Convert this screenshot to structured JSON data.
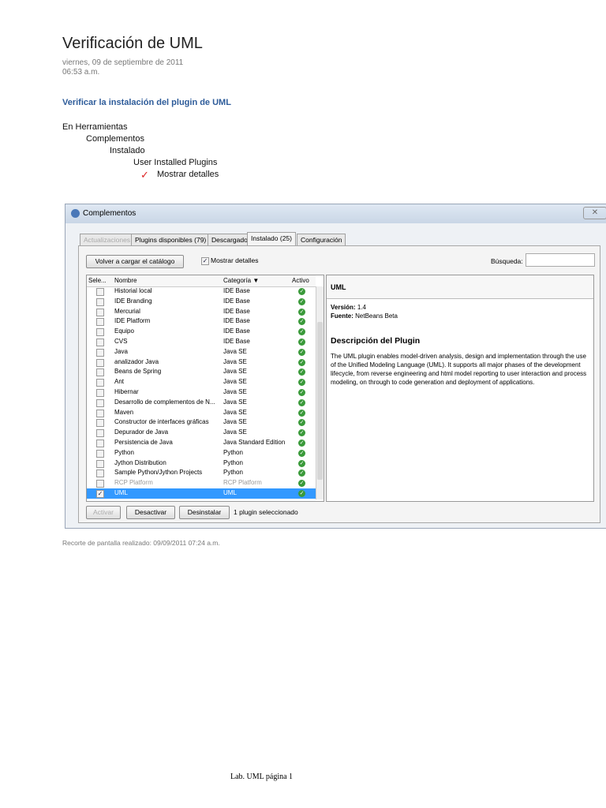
{
  "doc": {
    "title": "Verificación de UML",
    "date": "viernes, 09 de septiembre de 2011",
    "time": "06:53 a.m.",
    "subtitle": "Verificar la instalación del plugin de UML",
    "steps": [
      "En Herramientas",
      "Complementos",
      "Instalado",
      "User Installed Plugins",
      "Mostrar detalles"
    ],
    "caption": "Recorte de pantalla realizado: 09/09/2011 07:24 a.m.",
    "footer": "Lab. UML página 1"
  },
  "dialog": {
    "title": "Complementos",
    "close": "✕",
    "tabs": [
      "Actualizaciones",
      "Plugins disponibles (79)",
      "Descargado",
      "Instalado (25)",
      "Configuración"
    ],
    "reload": "Volver a cargar el catálogo",
    "show_details": "Mostrar detalles",
    "search_label": "Búsqueda:",
    "search_value": "",
    "columns": [
      "Sele...",
      "Nombre",
      "Categoría ▼",
      "Activo"
    ],
    "rows": [
      {
        "name": "Historial local",
        "cat": "IDE Base"
      },
      {
        "name": "IDE Branding",
        "cat": "IDE Base"
      },
      {
        "name": "Mercurial",
        "cat": "IDE Base"
      },
      {
        "name": "IDE Platform",
        "cat": "IDE Base"
      },
      {
        "name": "Equipo",
        "cat": "IDE Base"
      },
      {
        "name": "CVS",
        "cat": "IDE Base"
      },
      {
        "name": "Java",
        "cat": "Java SE"
      },
      {
        "name": "analizador Java",
        "cat": "Java SE"
      },
      {
        "name": "Beans de Spring",
        "cat": "Java SE"
      },
      {
        "name": "Ant",
        "cat": "Java SE"
      },
      {
        "name": "Hibernar",
        "cat": "Java SE"
      },
      {
        "name": "Desarrollo de complementos de N...",
        "cat": "Java SE"
      },
      {
        "name": "Maven",
        "cat": "Java SE"
      },
      {
        "name": "Constructor de interfaces gráficas",
        "cat": "Java SE"
      },
      {
        "name": "Depurador de Java",
        "cat": "Java SE"
      },
      {
        "name": "Persistencia de Java",
        "cat": "Java Standard Edition"
      },
      {
        "name": "Python",
        "cat": "Python"
      },
      {
        "name": "Jython Distribution",
        "cat": "Python"
      },
      {
        "name": "Sample Python/Jython Projects",
        "cat": "Python"
      },
      {
        "name": "RCP Platform",
        "cat": "RCP Platform"
      },
      {
        "name": "UML",
        "cat": "UML"
      }
    ],
    "detail": {
      "name": "UML",
      "version_label": "Versión:",
      "version": "1.4",
      "source_label": "Fuente:",
      "source": "NetBeans Beta",
      "desc_title": "Descripción del Plugin",
      "desc": "The UML plugin enables model-driven analysis, design and implementation through the use of the Unified Modeling Language (UML). It supports all major phases of the development lifecycle, from reverse engineering and html model reporting to user interaction and process modeling, on through to code generation and deployment of applications."
    },
    "activate": "Activar",
    "deactivate": "Desactivar",
    "uninstall": "Desinstalar",
    "status": "1 plugin seleccionado"
  }
}
